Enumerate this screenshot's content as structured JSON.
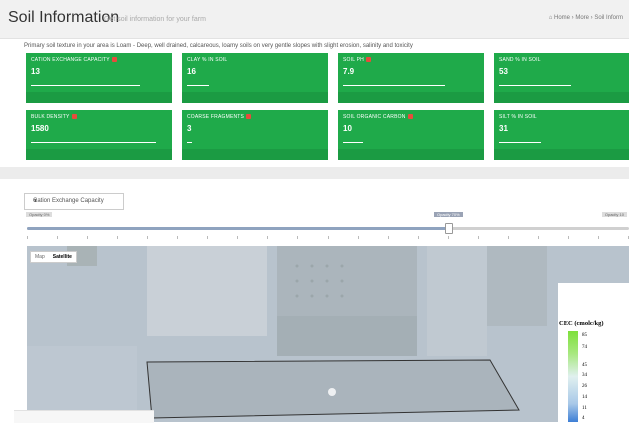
{
  "header": {
    "title": "Soil Information",
    "subtitle": "Get soil information for your farm",
    "breadcrumb": "Home  ›  More  ›  Soil Inform"
  },
  "intro": "Primary soil texture in your area is Loam - Deep, well drained, calcareous, loamy soils on very gentle slopes with slight erosion, salinity and toxicity",
  "cards": [
    {
      "label": "CATION EXCHANGE CAPACITY",
      "value": "13",
      "help": true,
      "bar": 0.8
    },
    {
      "label": "CLAY % IN SOIL",
      "value": "16",
      "help": false,
      "bar": 0.16
    },
    {
      "label": "SOIL PH",
      "value": "7.9",
      "help": true,
      "bar": 0.75
    },
    {
      "label": "SAND % IN SOIL",
      "value": "53",
      "help": false,
      "bar": 0.53
    },
    {
      "label": "BULK DENSITY",
      "value": "1580",
      "help": true,
      "bar": 0.92
    },
    {
      "label": "COARSE FRAGMENTS",
      "value": "3",
      "help": true,
      "bar": 0.04
    },
    {
      "label": "SOIL ORGANIC CARBON",
      "value": "10",
      "help": true,
      "bar": 0.15
    },
    {
      "label": "SILT % IN SOIL",
      "value": "31",
      "help": false,
      "bar": 0.31
    }
  ],
  "layer_select": {
    "selected": "Cation Exchange Capacity"
  },
  "slider": {
    "min_label": "Opacity 0%",
    "current_label": "Opacity 70%",
    "max_label": "Opacity 10",
    "value": 0.7
  },
  "map": {
    "tabs": [
      "Map",
      "Satellite"
    ],
    "active_tab": "Satellite",
    "legend_title": "CEC (cmolc/kg)",
    "legend_ticks": [
      "85",
      "74",
      "45",
      "34",
      "26",
      "14",
      "11",
      "4"
    ]
  },
  "colors": {
    "card_green": "#1faa4a",
    "accent": "#8fa3bf",
    "help_badge": "#e74c3c"
  },
  "icons": {
    "breadcrumb": "home-icon",
    "select": "caret-down-icon",
    "help": "question-icon"
  }
}
